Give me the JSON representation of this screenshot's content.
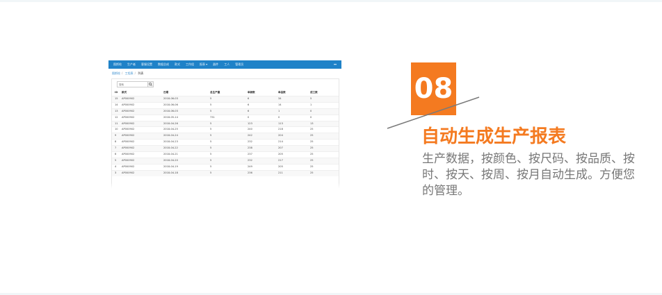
{
  "colors": {
    "accent": "#f47a20",
    "nav": "#1f82c8",
    "desc": "#777777"
  },
  "screenshot": {
    "nav_items": [
      "图斯绘",
      "生产者",
      "客服设置",
      "数据总成",
      "款式",
      "工作组",
      "报表",
      "器件",
      "工人",
      "管理员"
    ],
    "nav_dropdown_icon": "caret-down-icon",
    "user_menu": "▾▾",
    "breadcrumb": {
      "home": "图斯绘",
      "section": "工程表",
      "current": "列表"
    },
    "search": {
      "placeholder": "搜索",
      "icon": "search-icon"
    },
    "table": {
      "headers": [
        "ID",
        "款式",
        "日期",
        "总生产量",
        "单颜数",
        "单品数",
        "成工数"
      ],
      "rows": [
        [
          "15",
          "AP000902",
          "2018-06-03",
          "5",
          "6",
          "34",
          "5"
        ],
        [
          "14",
          "AP000902",
          "2018-06-06",
          "5",
          "6",
          "14",
          "1"
        ],
        [
          "13",
          "AP000902",
          "2018-06-03",
          "5",
          "6",
          "1",
          "0"
        ],
        [
          "12",
          "AP000902",
          "2018-05-14",
          "731",
          "0",
          "0",
          "0"
        ],
        [
          "11",
          "AP000902",
          "2018-04-26",
          "5",
          "123",
          "113",
          "13"
        ],
        [
          "10",
          "AP000902",
          "2018-04-25",
          "5",
          "240",
          "218",
          "25"
        ],
        [
          "9",
          "AP000902",
          "2018-04-24",
          "5",
          "242",
          "204",
          "25"
        ],
        [
          "8",
          "AP000902",
          "2018-04-23",
          "5",
          "232",
          "214",
          "25"
        ],
        [
          "7",
          "AP000902",
          "2018-04-22",
          "5",
          "238",
          "207",
          "25"
        ],
        [
          "6",
          "AP000902",
          "2018-04-21",
          "5",
          "237",
          "205",
          "25"
        ],
        [
          "5",
          "AP000902",
          "2018-04-20",
          "5",
          "232",
          "217",
          "25"
        ],
        [
          "4",
          "AP000902",
          "2018-04-19",
          "5",
          "249",
          "205",
          "25"
        ],
        [
          "3",
          "AP000902",
          "2018-04-18",
          "5",
          "236",
          "211",
          "25"
        ]
      ]
    }
  },
  "feature": {
    "number": "08",
    "title": "自动生成生产报表",
    "description": "生产数据，按颜色、按尺码、按品质、按时、按天、按周、按月自动生成。方便您的管理。"
  }
}
